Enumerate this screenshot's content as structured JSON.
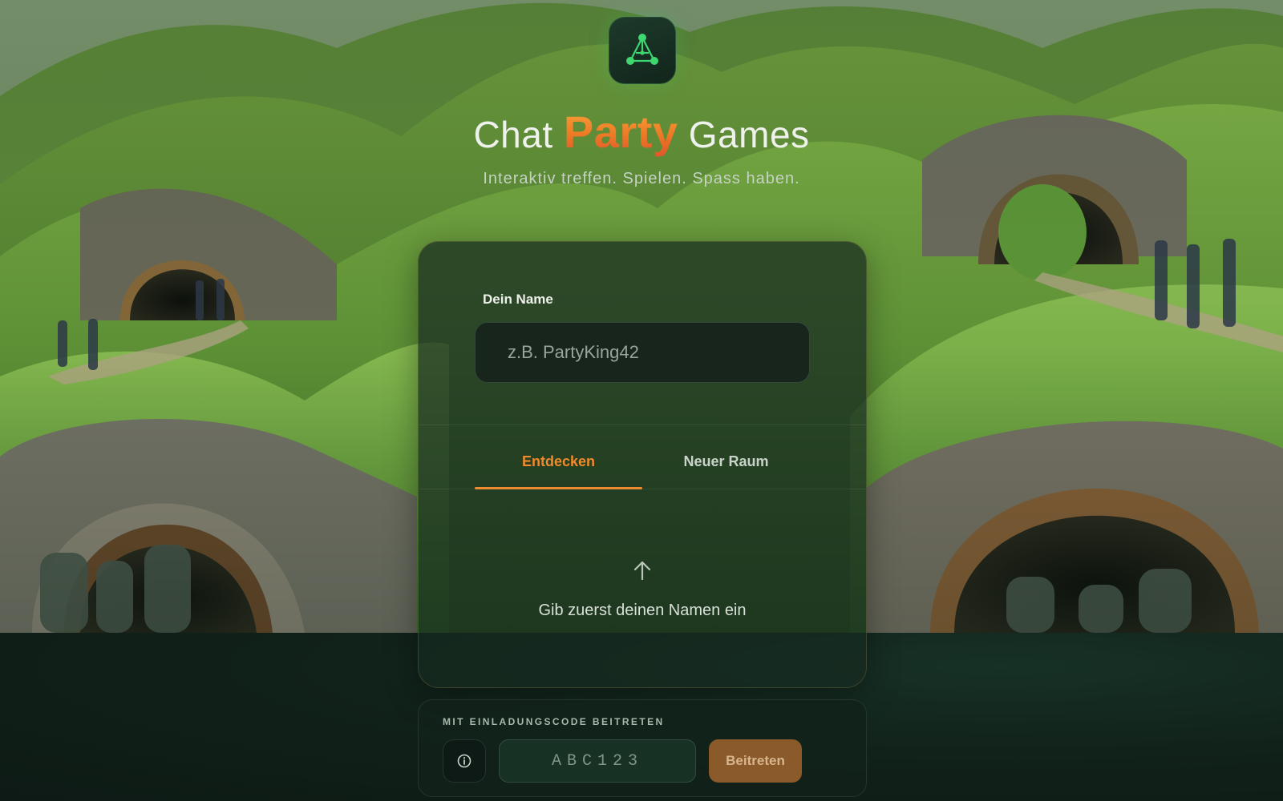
{
  "app": {
    "title_prefix": "Chat",
    "title_accent": "Party",
    "title_suffix": "Games",
    "subtitle": "Interaktiv treffen. Spielen. Spass haben."
  },
  "name_section": {
    "label": "Dein Name",
    "placeholder": "z.B. PartyKing42",
    "value": ""
  },
  "tabs": [
    {
      "label": "Entdecken",
      "active": true
    },
    {
      "label": "Neuer Raum",
      "active": false
    }
  ],
  "hint": {
    "icon": "arrow-up-icon",
    "text": "Gib zuerst deinen Namen ein"
  },
  "invite": {
    "label": "MIT EINLADUNGSCODE BEITRETEN",
    "info_icon": "info-icon",
    "code_placeholder": "ABC123",
    "code_value": "",
    "join_label": "Beitreten"
  },
  "colors": {
    "accent": "#f08a2c",
    "logo_green": "#3fd66f",
    "background": "#0f1c16",
    "card": "#16281f"
  }
}
